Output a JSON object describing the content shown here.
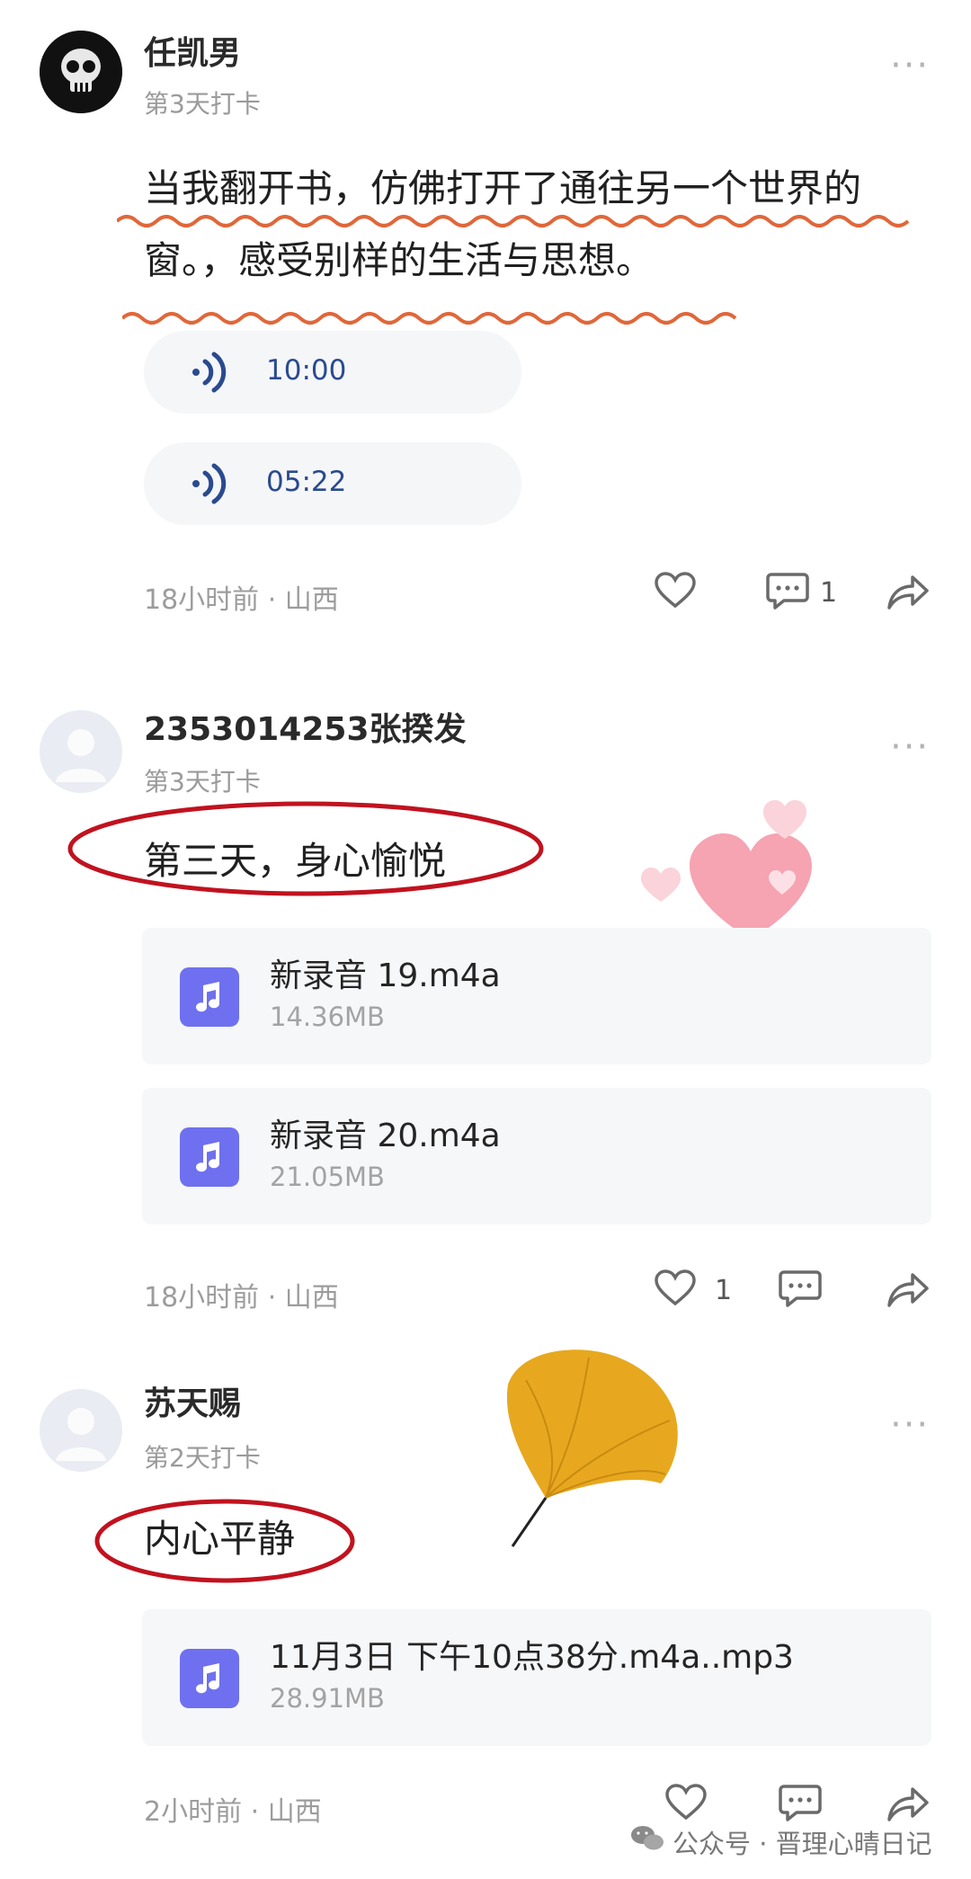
{
  "posts": [
    {
      "user": "任凯男",
      "day": "第3天打卡",
      "text": [
        "当我翻开书，仿佛打开了通往另一个世界的",
        "窗。，感受别样的生活与思想。"
      ],
      "voices": [
        "10:00",
        "05:22"
      ],
      "time": "18小时前 · 山西",
      "comment_count": "1"
    },
    {
      "user": "2353014253张揆发",
      "day": "第3天打卡",
      "text": "第三天，身心愉悦",
      "files": [
        {
          "name": "新录音 19.m4a",
          "size": "14.36MB"
        },
        {
          "name": "新录音 20.m4a",
          "size": "21.05MB"
        }
      ],
      "time": "18小时前 · 山西",
      "like_count": "1"
    },
    {
      "user": "苏天赐",
      "day": "第2天打卡",
      "text": "内心平静",
      "files": [
        {
          "name": "11月3日 下午10点38分.m4a..mp3",
          "size": "28.91MB"
        }
      ],
      "time": "2小时前 · 山西"
    }
  ],
  "more_label": "···",
  "watermark": "公众号 · 晋理心晴日记",
  "colors": {
    "accent_wave": "#e0673a",
    "circle_red": "#c1121f",
    "file_icon": "#6e70ef",
    "voice_text": "#2a4a8f"
  }
}
